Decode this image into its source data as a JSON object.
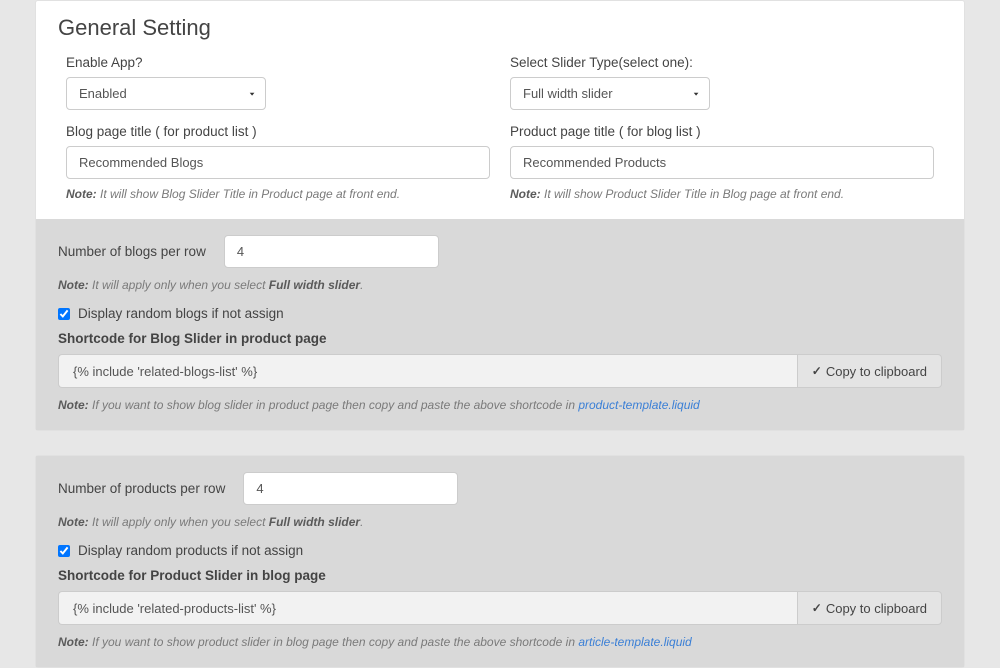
{
  "title": "General Setting",
  "top": {
    "enable": {
      "label": "Enable App?",
      "value": "Enabled"
    },
    "sliderType": {
      "label": "Select Slider Type(select one):",
      "value": "Full width slider"
    },
    "blogTitle": {
      "label": "Blog page title ( for product list )",
      "value": "Recommended Blogs",
      "noteBold": "Note:",
      "noteText": " It will show Blog Slider Title in Product page at front end."
    },
    "productTitle": {
      "label": "Product page title ( for blog list )",
      "value": "Recommended Products",
      "noteBold": "Note:",
      "noteText": " It will show Product Slider Title in Blog page at front end."
    }
  },
  "blogSection": {
    "perRowLabel": "Number of blogs per row",
    "perRowValue": "4",
    "noteBold": "Note:",
    "noteText1": " It will apply only when you select ",
    "noteBold2": "Full width slider",
    "noteText2": ".",
    "randomLabel": "Display random blogs if not assign",
    "shortcodeLabel": "Shortcode for Blog Slider in product page",
    "shortcodeValue": "{% include 'related-blogs-list' %}",
    "copyLabel": "Copy to clipboard",
    "note2Bold": "Note:",
    "note2Text": " If you want to show blog slider in product page then copy and paste the above shortcode in ",
    "note2Link": "product-template.liquid"
  },
  "productSection": {
    "perRowLabel": "Number of products per row",
    "perRowValue": "4",
    "noteBold": "Note:",
    "noteText1": " It will apply only when you select ",
    "noteBold2": "Full width slider",
    "noteText2": ".",
    "randomLabel": "Display random products if not assign",
    "shortcodeLabel": "Shortcode for Product Slider in blog page",
    "shortcodeValue": "{% include 'related-products-list' %}",
    "copyLabel": "Copy to clipboard",
    "note2Bold": "Note:",
    "note2Text": " If you want to show product slider in blog page then copy and paste the above shortcode in ",
    "note2Link": "article-template.liquid"
  }
}
